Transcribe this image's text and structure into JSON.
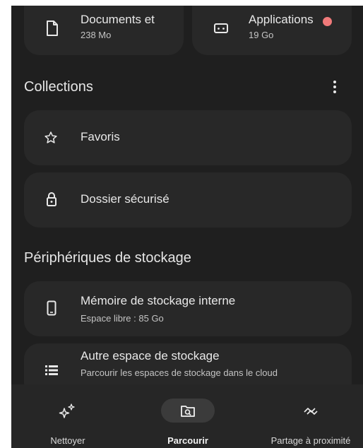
{
  "categories": [
    {
      "name": "Documents et",
      "size": "238 Mo",
      "icon": "document-icon"
    },
    {
      "name": "Applications",
      "size": "19 Go",
      "icon": "android-icon",
      "badge_color": "#f07a7a"
    }
  ],
  "collections": {
    "title": "Collections",
    "items": [
      {
        "label": "Favoris",
        "icon": "star-icon"
      },
      {
        "label": "Dossier sécurisé",
        "icon": "lock-icon"
      }
    ]
  },
  "storage": {
    "title": "Périphériques de stockage",
    "items": [
      {
        "label": "Mémoire de stockage interne",
        "sub": "Espace libre : 85 Go",
        "icon": "phone-icon"
      },
      {
        "label": "Autre espace de stockage",
        "sub": "Parcourir les espaces de stockage dans le cloud",
        "icon": "list-icon"
      }
    ]
  },
  "bottom_nav": {
    "active": "Parcourir",
    "items": [
      {
        "label": "Nettoyer",
        "icon": "sparkle-icon"
      },
      {
        "label": "Parcourir",
        "icon": "browse-folder-icon"
      },
      {
        "label": "Partage à proximité",
        "icon": "nearby-share-icon"
      }
    ]
  },
  "colors": {
    "background": "#1f1f1f",
    "card": "#282828",
    "nav_background": "#262626",
    "active_pill": "#3b3b3b",
    "badge": "#f07a7a"
  }
}
